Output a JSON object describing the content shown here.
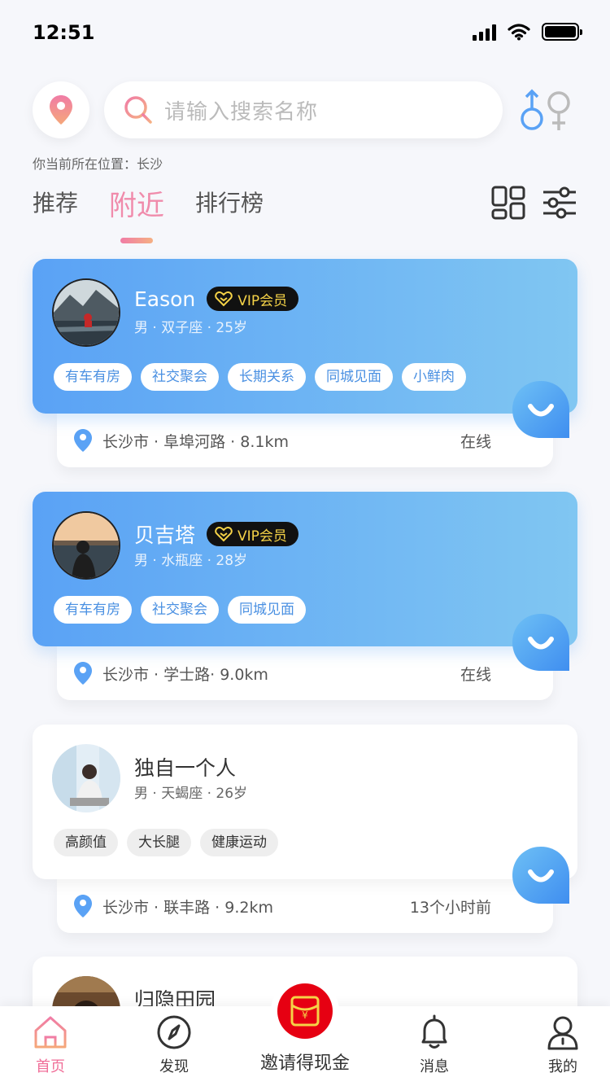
{
  "status_bar": {
    "time": "12:51"
  },
  "search": {
    "placeholder": "请输入搜索名称"
  },
  "current_location": "你当前所在位置：长沙",
  "tabs": [
    {
      "label": "推荐"
    },
    {
      "label": "附近"
    },
    {
      "label": "排行榜"
    }
  ],
  "active_tab": "附近",
  "users": [
    {
      "name": "Eason",
      "vip": "VIP会员",
      "info": "男 · 双子座 · 25岁",
      "tags": [
        "有车有房",
        "社交聚会",
        "长期关系",
        "同城见面",
        "小鲜肉"
      ],
      "address": "长沙市 · 阜埠河路 · 8.1km",
      "status": "在线"
    },
    {
      "name": "贝吉塔",
      "vip": "VIP会员",
      "info": "男 · 水瓶座 · 28岁",
      "tags": [
        "有车有房",
        "社交聚会",
        "同城见面"
      ],
      "address": "长沙市 · 学士路· 9.0km",
      "status": "在线"
    },
    {
      "name": "独自一个人",
      "info": "男 · 天蝎座 · 26岁",
      "tags": [
        "高颜值",
        "大长腿",
        "健康运动"
      ],
      "address": "长沙市 · 联丰路 · 9.2km",
      "status": "13个小时前"
    },
    {
      "name": "归隐田园"
    }
  ],
  "bottom_nav": {
    "home": "首页",
    "discover": "发现",
    "invite": "邀请得现金",
    "messages": "消息",
    "mine": "我的"
  },
  "colors": {
    "accent_pink": "#f08bab",
    "vip_gradient_start": "#5aa2f5",
    "vip_gradient_end": "#80c6f2",
    "vip_gold": "#f5d247",
    "invite_red": "#e60012"
  }
}
